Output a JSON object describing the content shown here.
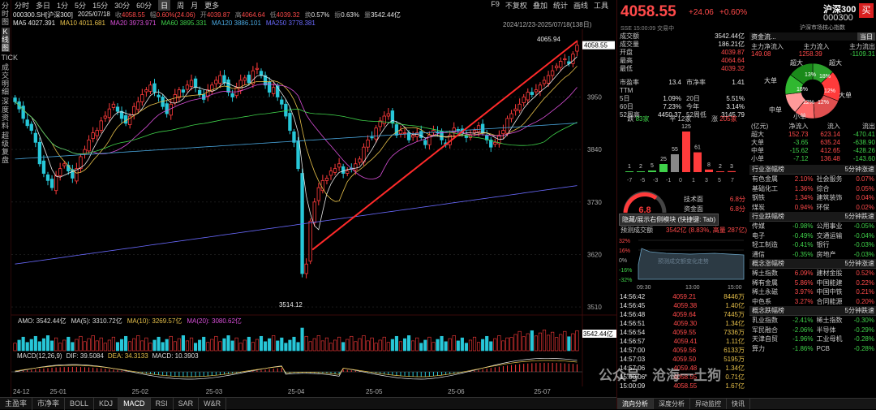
{
  "left_nav": [
    "分时图",
    "K线图",
    "TICK",
    "成交明细",
    "深度资料",
    "超级复盘"
  ],
  "toolbar": {
    "tabs": [
      "分时",
      "多日",
      "1分",
      "5分",
      "15分",
      "30分",
      "60分",
      "日",
      "周",
      "月",
      "更多"
    ],
    "active_tab": "日",
    "right": [
      "F9",
      "不复权",
      "叠加",
      "统计",
      "画线",
      "工具"
    ]
  },
  "info": {
    "code": "000300.SH[沪深300]",
    "date": "2025/07/18",
    "close_label": "收",
    "close": "4058.55",
    "change_label": "幅",
    "change": "0.60%(24.06)",
    "open_label": "开",
    "open": "4039.87",
    "high_label": "高",
    "high": "4064.64",
    "low_label": "低",
    "low": "4039.32",
    "turnover_label": "换",
    "turnover": "0.57%",
    "amplitude_label": "振",
    "amplitude": "0.63%",
    "amount_label": "量",
    "amount": "3542.44亿"
  },
  "ma": [
    {
      "label": "MA5",
      "value": "4027.391",
      "color": "#e8e8e8"
    },
    {
      "label": "MA10",
      "value": "4011.681",
      "color": "#e7c04a"
    },
    {
      "label": "MA20",
      "value": "3973.971",
      "color": "#d94fd9"
    },
    {
      "label": "MA60",
      "value": "3895.331",
      "color": "#3fd14a"
    },
    {
      "label": "MA120",
      "value": "3886.101",
      "color": "#4aa8e0"
    },
    {
      "label": "MA250",
      "value": "3778.381",
      "color": "#6a6aff"
    }
  ],
  "range_label": "2024/12/23-2025/07/18(138日)",
  "price_axis": [
    "3950",
    "3840",
    "3730",
    "3620",
    "3510"
  ],
  "price_tag": "4058.55",
  "high_annot": "4065.94",
  "low_annot": "3514.12",
  "vol_bar": {
    "amo": "AMO: 3542.44亿",
    "ma5": "MA(5): 3310.72亿",
    "ma10": "MA(10): 3269.57亿",
    "ma20": "MA(20): 3080.62亿",
    "tag": "3542.44亿"
  },
  "macd_bar": {
    "name": "MACD(12,26,9)",
    "dif": "DIF: 39.5084",
    "dea": "DEA: 34.3133",
    "macd": "MACD: 10.3903"
  },
  "date_axis": [
    "24-12",
    "25-01",
    "25-02",
    "25-03",
    "25-04",
    "25-05",
    "25-06",
    "25-07"
  ],
  "bottom_tabs": [
    "主盈率",
    "市净率",
    "BOLL",
    "KDJ",
    "MACD",
    "RSI",
    "SAR",
    "W&R"
  ],
  "active_bottom": "MACD",
  "chart_data": {
    "type": "candlestick",
    "closes": [
      3940,
      3925,
      3905,
      3890,
      3880,
      3855,
      3810,
      3790,
      3775,
      3760,
      3785,
      3800,
      3810,
      3795,
      3780,
      3800,
      3825,
      3840,
      3860,
      3875,
      3880,
      3900,
      3910,
      3925,
      3935,
      3920,
      3905,
      3895,
      3910,
      3930,
      3940,
      3955,
      3965,
      3975,
      3960,
      3950,
      3930,
      3915,
      3935,
      3955,
      3965,
      3960,
      3975,
      3985,
      3970,
      3955,
      3945,
      3965,
      3975,
      3985,
      3995,
      3980,
      3960,
      3950,
      3970,
      3985,
      3990,
      3980,
      4005,
      4010,
      3995,
      3975,
      3960,
      3970,
      3950,
      3935,
      3910,
      3880,
      3855,
      3800,
      3580,
      3600,
      3690,
      3730,
      3760,
      3775,
      3780,
      3795,
      3800,
      3810,
      3790,
      3795,
      3800,
      3810,
      3820,
      3845,
      3860,
      3865,
      3885,
      3900,
      3910,
      3915,
      3895,
      3870,
      3880,
      3875,
      3860,
      3870,
      3875,
      3865,
      3850,
      3870,
      3880,
      3875,
      3860,
      3850,
      3870,
      3885,
      3880,
      3875,
      3865,
      3870,
      3880,
      3890,
      3875,
      3860,
      3845,
      3855,
      3870,
      3880,
      3905,
      3915,
      3925,
      3935,
      3950,
      3960,
      3955,
      3965,
      3975,
      3985,
      3995,
      4005,
      4015,
      4025,
      4030,
      4020,
      4040,
      4058.55
    ],
    "ylim": [
      3500,
      4075
    ],
    "ma_series": [
      "MA5",
      "MA10",
      "MA20",
      "MA60",
      "MA120",
      "MA250"
    ],
    "volume_ylim": [
      0,
      3600
    ],
    "macd_ylim": [
      -80,
      60
    ]
  },
  "right": {
    "title": "沪深300",
    "code": "000300",
    "buy_btn": "买",
    "price": "4058.55",
    "chg": "+24.06",
    "pct": "+0.60%",
    "sub": "SSE 15:00:09 交易中",
    "sub2": "沪深市场核心指数",
    "stats": [
      {
        "k": "成交额",
        "v": "3542.44亿"
      },
      {
        "k": "成交量",
        "v": "186.21亿"
      },
      {
        "k": "开盘",
        "v": "4039.87"
      },
      {
        "k": "最高",
        "v": "4064.64"
      },
      {
        "k": "最低",
        "v": "4039.32"
      }
    ],
    "pe": [
      {
        "k": "市盈率TTM",
        "v": "13.4",
        "k2": "市净率",
        "v2": "1.41"
      },
      {
        "k": "5日",
        "v": "1.09%",
        "k2": "20日",
        "v2": "5.51%"
      },
      {
        "k": "60日",
        "v": "7.23%",
        "k2": "今年",
        "v2": "3.14%"
      },
      {
        "k": "52周高",
        "v": "4450.37",
        "k2": "52周低",
        "v2": "3145.79"
      }
    ],
    "breadth": {
      "down_label": "跌",
      "down": "83家",
      "flat_label": "平",
      "flat": "12家",
      "up_label": "涨",
      "up": "205家"
    },
    "dist_labels": [
      "-7",
      "-5",
      "-3",
      "-1",
      "0",
      "1",
      "3",
      "5",
      "7"
    ],
    "dist_values": [
      "1",
      "2",
      "5",
      "25",
      "55",
      "125",
      "61",
      "8",
      "2",
      "3"
    ],
    "score": "6.8",
    "score_tech": "技术面",
    "score_tech_v": "6.8分",
    "score_fund": "资金面",
    "score_fund_v": "6.8分",
    "hide_tip": "隐藏/展示右侧模块 (快捷键: Tab)",
    "forecast": "预测成交额",
    "forecast_v": "3542亿 (8.83%, 高量 287亿)",
    "pct_axis": [
      "32%",
      "16%",
      "0%",
      "-16%",
      "-32%"
    ],
    "time_axis": [
      "09:30",
      "13:00",
      "15:00"
    ],
    "forecast_watermark": "预测成交额变化走势",
    "flow": {
      "title": "资金流...",
      "today": "当日",
      "h1": "主力净流入",
      "h2": "主力流入",
      "h3": "主力流出",
      "v1": "149.08",
      "v2": "1258.39",
      "v3": "-1109.31",
      "pie_labels": [
        "超大",
        "超大",
        "大单",
        "大单",
        "中单",
        "中单",
        "小单",
        "小单"
      ],
      "pie_values": [
        "13%",
        "18%",
        "18%",
        "12%",
        "12%",
        "12%",
        "12%",
        "12%"
      ]
    },
    "flow_table": {
      "headers": [
        "(亿元)",
        "净流入",
        "流入",
        "流出"
      ],
      "rows": [
        [
          "超大",
          "152.73",
          "623.14",
          "-470.41"
        ],
        [
          "大单",
          "-3.65",
          "635.24",
          "-638.90"
        ],
        [
          "中单",
          "-15.62",
          "412.65",
          "-428.26"
        ],
        [
          "小单",
          "-7.12",
          "136.48",
          "-143.60"
        ]
      ]
    },
    "ind_up": {
      "title": "行业涨幅榜",
      "title2": "5分钟涨速",
      "rows": [
        [
          "有色金属",
          "2.10%",
          "社会服务",
          "0.07%"
        ],
        [
          "基础化工",
          "1.36%",
          "综合",
          "0.05%"
        ],
        [
          "钢铁",
          "1.34%",
          "建筑装饰",
          "0.04%"
        ],
        [
          "煤炭",
          "0.94%",
          "环保",
          "0.02%"
        ]
      ]
    },
    "ind_down": {
      "title": "行业跌幅榜",
      "title2": "5分钟跌速",
      "rows": [
        [
          "传媒",
          "-0.98%",
          "公用事业",
          "-0.05%"
        ],
        [
          "电子",
          "-0.49%",
          "交通运输",
          "-0.04%"
        ],
        [
          "轻工制造",
          "-0.41%",
          "银行",
          "-0.03%"
        ],
        [
          "通信",
          "-0.35%",
          "房地产",
          "-0.03%"
        ]
      ]
    },
    "concept_up": {
      "title": "概念涨幅榜",
      "title2": "5分钟涨速",
      "rows": [
        [
          "稀土指数",
          "6.09%",
          "建材金股",
          "0.52%"
        ],
        [
          "稀有金属",
          "5.86%",
          "中国能建",
          "0.22%"
        ],
        [
          "稀土永磁",
          "3.97%",
          "中国中铁",
          "0.21%"
        ],
        [
          "中色系",
          "3.27%",
          "合同能源",
          "0.20%"
        ]
      ]
    },
    "concept_down": {
      "title": "概念跌幅榜",
      "title2": "5分钟跌速",
      "rows": [
        [
          "乳业指数",
          "-2.41%",
          "稀土指数",
          "-0.30%"
        ],
        [
          "军民融合",
          "-2.06%",
          "半导体",
          "-0.29%"
        ],
        [
          "天津自贸",
          "-1.96%",
          "工业母机",
          "-0.28%"
        ],
        [
          "算力",
          "-1.86%",
          "PCB",
          "-0.28%"
        ]
      ]
    },
    "ticks": [
      [
        "14:56:42",
        "4059.21",
        "8446万"
      ],
      [
        "14:56:45",
        "4059.38",
        "1.40亿"
      ],
      [
        "14:56:48",
        "4059.64",
        "7445万"
      ],
      [
        "14:56:51",
        "4059.30",
        "1.34亿"
      ],
      [
        "14:56:54",
        "4059.55",
        "7336万"
      ],
      [
        "14:56:57",
        "4059.41",
        "1.11亿"
      ],
      [
        "14:57:00",
        "4059.56",
        "6133万"
      ],
      [
        "14:57:03",
        "4059.50",
        "5195万"
      ],
      [
        "14:57:06",
        "4059.48",
        "1.34亿"
      ],
      [
        "15:00:06",
        "4058.55",
        "0.71亿"
      ],
      [
        "15:00:09",
        "4058.55",
        "1.67亿"
      ]
    ],
    "bottom_tabs": [
      "流向分析",
      "深度分析",
      "异动监控",
      "快讯"
    ]
  },
  "watermark": "公众号 · 沧海一土狗"
}
